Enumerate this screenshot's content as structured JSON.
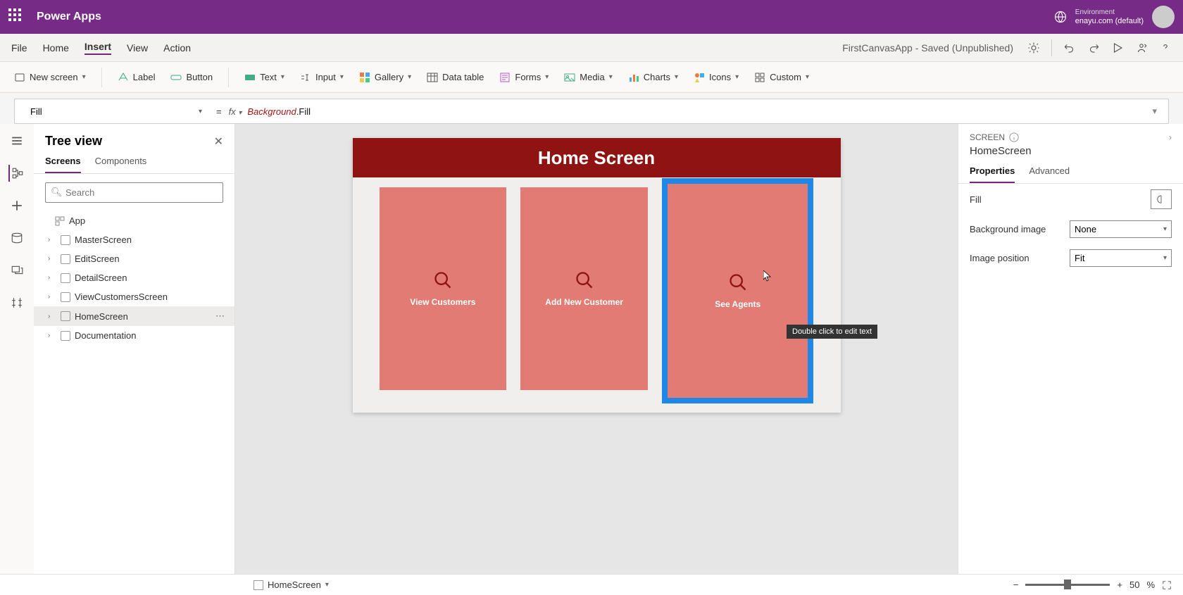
{
  "header": {
    "app_name": "Power Apps",
    "env_label": "Environment",
    "env_value": "enayu.com (default)"
  },
  "menubar": {
    "items": [
      "File",
      "Home",
      "Insert",
      "View",
      "Action"
    ],
    "active_index": 2,
    "doc_status": "FirstCanvasApp - Saved (Unpublished)"
  },
  "ribbon": {
    "items": [
      "New screen",
      "Label",
      "Button",
      "Text",
      "Input",
      "Gallery",
      "Data table",
      "Forms",
      "Media",
      "Charts",
      "Icons",
      "Custom"
    ]
  },
  "formula": {
    "property": "Fill",
    "fx": "fx",
    "expr_obj": "Background",
    "expr_prop": ".Fill"
  },
  "tree": {
    "title": "Tree view",
    "tabs": [
      "Screens",
      "Components"
    ],
    "active_tab": 0,
    "search_placeholder": "Search",
    "items": [
      {
        "label": "App",
        "expandable": false,
        "kind": "app"
      },
      {
        "label": "MasterScreen",
        "expandable": true
      },
      {
        "label": "EditScreen",
        "expandable": true
      },
      {
        "label": "DetailScreen",
        "expandable": true
      },
      {
        "label": "ViewCustomersScreen",
        "expandable": true
      },
      {
        "label": "HomeScreen",
        "expandable": true,
        "selected": true
      },
      {
        "label": "Documentation",
        "expandable": true
      }
    ]
  },
  "canvas": {
    "screen_title": "Home Screen",
    "cards": [
      {
        "label": "View Customers"
      },
      {
        "label": "Add New Customer"
      },
      {
        "label": "See Agents",
        "selected": true
      }
    ],
    "tooltip": "Double click to edit text"
  },
  "props": {
    "section": "SCREEN",
    "title": "HomeScreen",
    "tabs": [
      "Properties",
      "Advanced"
    ],
    "active_tab": 0,
    "rows": [
      {
        "label": "Fill",
        "type": "color"
      },
      {
        "label": "Background image",
        "type": "select",
        "value": "None"
      },
      {
        "label": "Image position",
        "type": "select",
        "value": "Fit"
      }
    ]
  },
  "status": {
    "screen": "HomeScreen",
    "zoom_value": "50",
    "zoom_unit": "%"
  }
}
